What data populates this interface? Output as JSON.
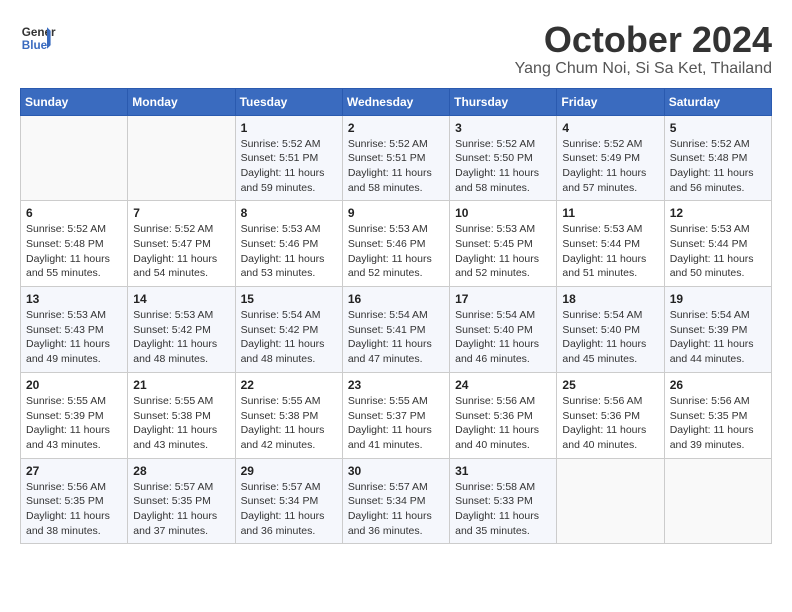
{
  "header": {
    "logo_line1": "General",
    "logo_line2": "Blue",
    "month": "October 2024",
    "location": "Yang Chum Noi, Si Sa Ket, Thailand"
  },
  "weekdays": [
    "Sunday",
    "Monday",
    "Tuesday",
    "Wednesday",
    "Thursday",
    "Friday",
    "Saturday"
  ],
  "weeks": [
    [
      {
        "day": "",
        "sunrise": "",
        "sunset": "",
        "daylight": ""
      },
      {
        "day": "",
        "sunrise": "",
        "sunset": "",
        "daylight": ""
      },
      {
        "day": "1",
        "sunrise": "Sunrise: 5:52 AM",
        "sunset": "Sunset: 5:51 PM",
        "daylight": "Daylight: 11 hours and 59 minutes."
      },
      {
        "day": "2",
        "sunrise": "Sunrise: 5:52 AM",
        "sunset": "Sunset: 5:51 PM",
        "daylight": "Daylight: 11 hours and 58 minutes."
      },
      {
        "day": "3",
        "sunrise": "Sunrise: 5:52 AM",
        "sunset": "Sunset: 5:50 PM",
        "daylight": "Daylight: 11 hours and 58 minutes."
      },
      {
        "day": "4",
        "sunrise": "Sunrise: 5:52 AM",
        "sunset": "Sunset: 5:49 PM",
        "daylight": "Daylight: 11 hours and 57 minutes."
      },
      {
        "day": "5",
        "sunrise": "Sunrise: 5:52 AM",
        "sunset": "Sunset: 5:48 PM",
        "daylight": "Daylight: 11 hours and 56 minutes."
      }
    ],
    [
      {
        "day": "6",
        "sunrise": "Sunrise: 5:52 AM",
        "sunset": "Sunset: 5:48 PM",
        "daylight": "Daylight: 11 hours and 55 minutes."
      },
      {
        "day": "7",
        "sunrise": "Sunrise: 5:52 AM",
        "sunset": "Sunset: 5:47 PM",
        "daylight": "Daylight: 11 hours and 54 minutes."
      },
      {
        "day": "8",
        "sunrise": "Sunrise: 5:53 AM",
        "sunset": "Sunset: 5:46 PM",
        "daylight": "Daylight: 11 hours and 53 minutes."
      },
      {
        "day": "9",
        "sunrise": "Sunrise: 5:53 AM",
        "sunset": "Sunset: 5:46 PM",
        "daylight": "Daylight: 11 hours and 52 minutes."
      },
      {
        "day": "10",
        "sunrise": "Sunrise: 5:53 AM",
        "sunset": "Sunset: 5:45 PM",
        "daylight": "Daylight: 11 hours and 52 minutes."
      },
      {
        "day": "11",
        "sunrise": "Sunrise: 5:53 AM",
        "sunset": "Sunset: 5:44 PM",
        "daylight": "Daylight: 11 hours and 51 minutes."
      },
      {
        "day": "12",
        "sunrise": "Sunrise: 5:53 AM",
        "sunset": "Sunset: 5:44 PM",
        "daylight": "Daylight: 11 hours and 50 minutes."
      }
    ],
    [
      {
        "day": "13",
        "sunrise": "Sunrise: 5:53 AM",
        "sunset": "Sunset: 5:43 PM",
        "daylight": "Daylight: 11 hours and 49 minutes."
      },
      {
        "day": "14",
        "sunrise": "Sunrise: 5:53 AM",
        "sunset": "Sunset: 5:42 PM",
        "daylight": "Daylight: 11 hours and 48 minutes."
      },
      {
        "day": "15",
        "sunrise": "Sunrise: 5:54 AM",
        "sunset": "Sunset: 5:42 PM",
        "daylight": "Daylight: 11 hours and 48 minutes."
      },
      {
        "day": "16",
        "sunrise": "Sunrise: 5:54 AM",
        "sunset": "Sunset: 5:41 PM",
        "daylight": "Daylight: 11 hours and 47 minutes."
      },
      {
        "day": "17",
        "sunrise": "Sunrise: 5:54 AM",
        "sunset": "Sunset: 5:40 PM",
        "daylight": "Daylight: 11 hours and 46 minutes."
      },
      {
        "day": "18",
        "sunrise": "Sunrise: 5:54 AM",
        "sunset": "Sunset: 5:40 PM",
        "daylight": "Daylight: 11 hours and 45 minutes."
      },
      {
        "day": "19",
        "sunrise": "Sunrise: 5:54 AM",
        "sunset": "Sunset: 5:39 PM",
        "daylight": "Daylight: 11 hours and 44 minutes."
      }
    ],
    [
      {
        "day": "20",
        "sunrise": "Sunrise: 5:55 AM",
        "sunset": "Sunset: 5:39 PM",
        "daylight": "Daylight: 11 hours and 43 minutes."
      },
      {
        "day": "21",
        "sunrise": "Sunrise: 5:55 AM",
        "sunset": "Sunset: 5:38 PM",
        "daylight": "Daylight: 11 hours and 43 minutes."
      },
      {
        "day": "22",
        "sunrise": "Sunrise: 5:55 AM",
        "sunset": "Sunset: 5:38 PM",
        "daylight": "Daylight: 11 hours and 42 minutes."
      },
      {
        "day": "23",
        "sunrise": "Sunrise: 5:55 AM",
        "sunset": "Sunset: 5:37 PM",
        "daylight": "Daylight: 11 hours and 41 minutes."
      },
      {
        "day": "24",
        "sunrise": "Sunrise: 5:56 AM",
        "sunset": "Sunset: 5:36 PM",
        "daylight": "Daylight: 11 hours and 40 minutes."
      },
      {
        "day": "25",
        "sunrise": "Sunrise: 5:56 AM",
        "sunset": "Sunset: 5:36 PM",
        "daylight": "Daylight: 11 hours and 40 minutes."
      },
      {
        "day": "26",
        "sunrise": "Sunrise: 5:56 AM",
        "sunset": "Sunset: 5:35 PM",
        "daylight": "Daylight: 11 hours and 39 minutes."
      }
    ],
    [
      {
        "day": "27",
        "sunrise": "Sunrise: 5:56 AM",
        "sunset": "Sunset: 5:35 PM",
        "daylight": "Daylight: 11 hours and 38 minutes."
      },
      {
        "day": "28",
        "sunrise": "Sunrise: 5:57 AM",
        "sunset": "Sunset: 5:35 PM",
        "daylight": "Daylight: 11 hours and 37 minutes."
      },
      {
        "day": "29",
        "sunrise": "Sunrise: 5:57 AM",
        "sunset": "Sunset: 5:34 PM",
        "daylight": "Daylight: 11 hours and 36 minutes."
      },
      {
        "day": "30",
        "sunrise": "Sunrise: 5:57 AM",
        "sunset": "Sunset: 5:34 PM",
        "daylight": "Daylight: 11 hours and 36 minutes."
      },
      {
        "day": "31",
        "sunrise": "Sunrise: 5:58 AM",
        "sunset": "Sunset: 5:33 PM",
        "daylight": "Daylight: 11 hours and 35 minutes."
      },
      {
        "day": "",
        "sunrise": "",
        "sunset": "",
        "daylight": ""
      },
      {
        "day": "",
        "sunrise": "",
        "sunset": "",
        "daylight": ""
      }
    ]
  ]
}
